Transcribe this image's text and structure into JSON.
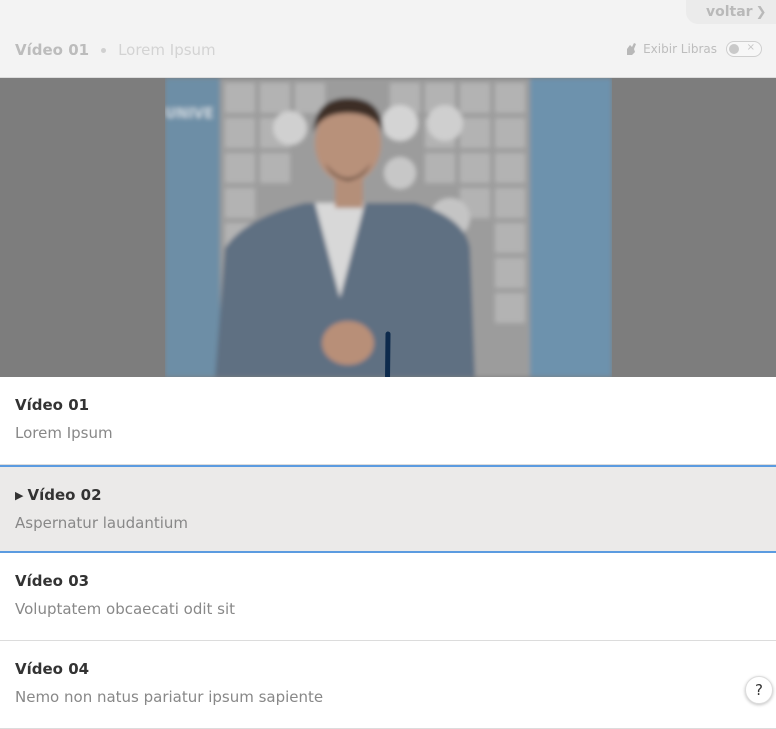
{
  "header": {
    "back_label": "voltar",
    "title": "Vídeo 01",
    "subtitle": "Lorem Ipsum",
    "libras_label": "Exibir Libras",
    "libras_toggle_state": "off"
  },
  "playlist": [
    {
      "title": "Vídeo 01",
      "description": "Lorem Ipsum",
      "active": false
    },
    {
      "title": "Vídeo 02",
      "description": "Aspernatur laudantium",
      "active": true
    },
    {
      "title": "Vídeo 03",
      "description": "Voluptatem obcaecati odit sit",
      "active": false
    },
    {
      "title": "Vídeo 04",
      "description": "Nemo non natus pariatur ipsum sapiente",
      "active": false
    }
  ],
  "help_label": "?",
  "colors": {
    "active_border": "#5b9be0",
    "active_bg": "#ebeae9",
    "overlay_arrow": "#0d2a4c"
  },
  "icons": {
    "back": "chevron-right-icon",
    "libras": "hand-icon",
    "overlay": "arrow-down-icon",
    "play": "play-icon"
  }
}
